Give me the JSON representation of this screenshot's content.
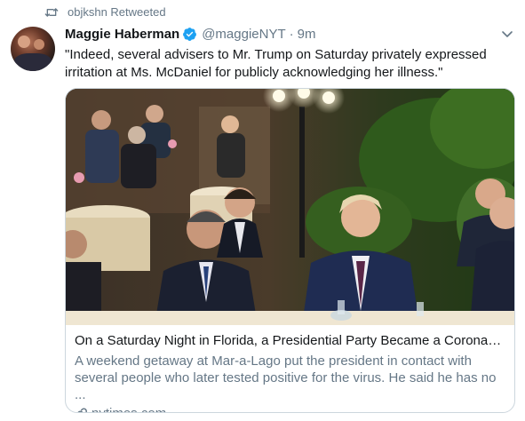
{
  "retweet": {
    "icon": "retweet-icon",
    "label": "objkshn Retweeted"
  },
  "tweet": {
    "author_name": "Maggie Haberman",
    "verified_icon": "verified-badge-icon",
    "handle": "@maggieNYT",
    "separator": "·",
    "time": "9m",
    "text": "\"Indeed, several advisers to Mr. Trump on Saturday privately expressed irritation at Ms. McDaniel for publicly acknowledging her illness.\"",
    "menu_icon": "chevron-down-icon"
  },
  "card": {
    "title": "On a Saturday Night in Florida, a Presidential Party Became a Coronavir...",
    "description": "A weekend getaway at Mar-a-Lago put the president in contact with several people who later tested positive for the virus. He said he has no ...",
    "link_icon": "link-icon",
    "domain": "nytimes.com"
  },
  "colors": {
    "accent": "#1da1f2",
    "secondary_text": "#657786",
    "border": "#ccd6dd"
  }
}
